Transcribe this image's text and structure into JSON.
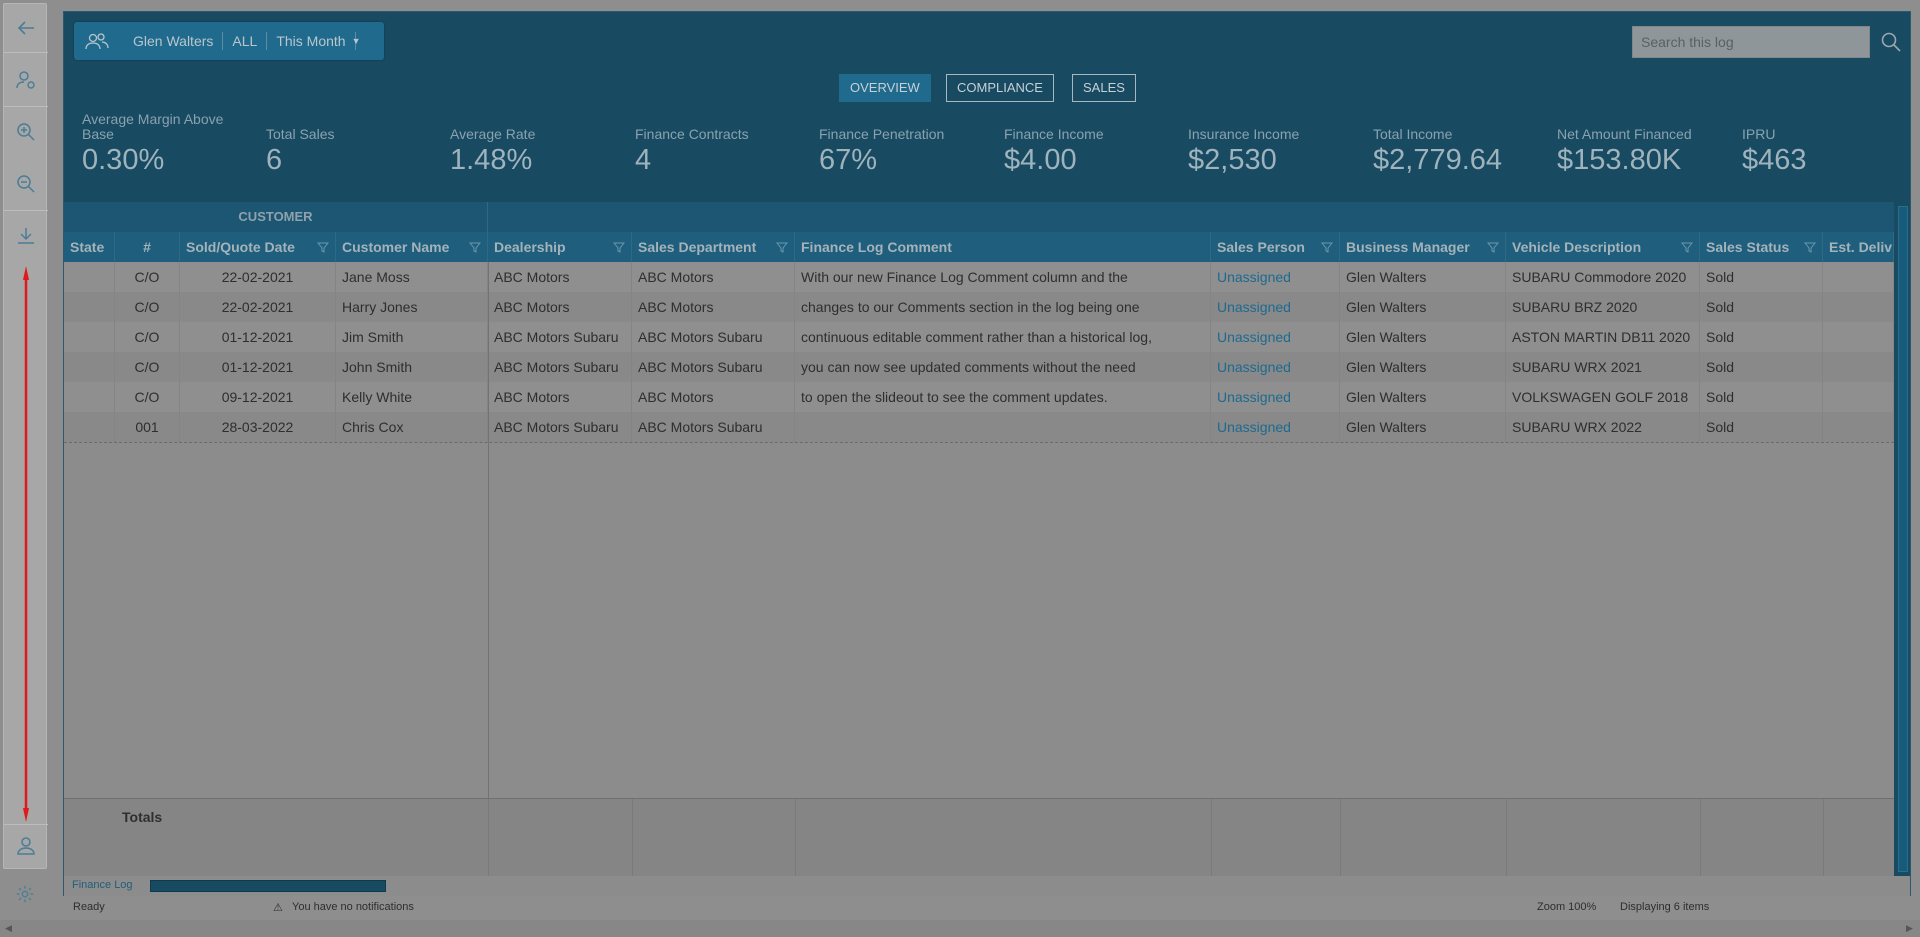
{
  "filter": {
    "user": "Glen Walters",
    "scope": "ALL",
    "period": "This Month"
  },
  "search": {
    "placeholder": "Search this log"
  },
  "tabs": [
    "OVERVIEW",
    "COMPLIANCE",
    "SALES"
  ],
  "stats": [
    {
      "label": "Average Margin Above Base",
      "value": "0.30%"
    },
    {
      "label": "Total Sales",
      "value": "6"
    },
    {
      "label": "Average Rate",
      "value": "1.48%"
    },
    {
      "label": "Finance Contracts",
      "value": "4"
    },
    {
      "label": "Finance Penetration",
      "value": "67%"
    },
    {
      "label": "Finance Income",
      "value": "$4.00"
    },
    {
      "label": "Insurance Income",
      "value": "$2,530"
    },
    {
      "label": "Total Income",
      "value": "$2,779.64"
    },
    {
      "label": "Net Amount Financed",
      "value": "$153.80K"
    },
    {
      "label": "IPRU",
      "value": "$463"
    }
  ],
  "grid": {
    "group_label": "CUSTOMER",
    "headers": [
      "State",
      "#",
      "Sold/Quote Date",
      "Customer Name",
      "Dealership",
      "Sales Department",
      "Finance Log Comment",
      "Sales Person",
      "Business Manager",
      "Vehicle Description",
      "Sales Status",
      "Est. Deliv"
    ],
    "rows": [
      [
        "",
        "C/O",
        "22-02-2021",
        "Jane Moss",
        "ABC Motors",
        "ABC Motors",
        "With our new Finance Log Comment column and the",
        "Unassigned",
        "Glen Walters",
        "SUBARU Commodore 2020",
        "Sold",
        ""
      ],
      [
        "",
        "C/O",
        "22-02-2021",
        "Harry Jones",
        "ABC Motors",
        "ABC Motors",
        "changes to our Comments section in the log being one",
        "Unassigned",
        "Glen Walters",
        "SUBARU BRZ 2020",
        "Sold",
        ""
      ],
      [
        "",
        "C/O",
        "01-12-2021",
        "Jim Smith",
        "ABC Motors Subaru",
        "ABC Motors Subaru",
        "continuous editable comment rather than a historical log,",
        "Unassigned",
        "Glen Walters",
        "ASTON MARTIN DB11 2020",
        "Sold",
        ""
      ],
      [
        "",
        "C/O",
        "01-12-2021",
        "John Smith",
        "ABC Motors Subaru",
        "ABC Motors Subaru",
        "you can now see updated comments without the need",
        "Unassigned",
        "Glen Walters",
        "SUBARU WRX 2021",
        "Sold",
        ""
      ],
      [
        "",
        "C/O",
        "09-12-2021",
        "Kelly White",
        "ABC Motors",
        "ABC Motors",
        "to open the slideout to see the comment updates.",
        "Unassigned",
        "Glen Walters",
        "VOLKSWAGEN GOLF 2018",
        "Sold",
        ""
      ],
      [
        "",
        "001",
        "28-03-2022",
        "Chris Cox",
        "ABC Motors Subaru",
        "ABC Motors Subaru",
        "",
        "Unassigned",
        "Glen Walters",
        "SUBARU WRX 2022",
        "Sold",
        ""
      ]
    ],
    "totals_label": "Totals",
    "sheet_tab": "Finance Log"
  },
  "status": {
    "ready": "Ready",
    "notifications": "You have no notifications",
    "zoom": "Zoom 100%",
    "displaying": "Displaying 6 items"
  },
  "colors": {
    "panel": "#184a62",
    "accent": "#1f6a8d",
    "link": "#1d6a8f",
    "annotation_arrow": "#e0191e"
  }
}
